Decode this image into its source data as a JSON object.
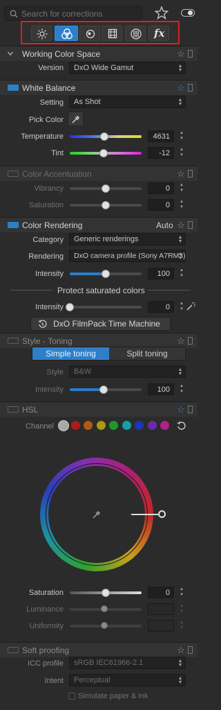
{
  "search": {
    "placeholder": "Search for corrections"
  },
  "toolbar": {
    "tabs": [
      {
        "icon": "sun-icon",
        "active": false
      },
      {
        "icon": "color-circles-icon",
        "active": true
      },
      {
        "icon": "lens-icon",
        "active": false
      },
      {
        "icon": "geometry-icon",
        "active": false
      },
      {
        "icon": "sliders-icon",
        "active": false
      },
      {
        "icon": "fx-icon",
        "active": false
      }
    ],
    "fx_label": "fx"
  },
  "working_color_space": {
    "title": "Working Color Space",
    "version_label": "Version",
    "version_value": "DxO Wide Gamut"
  },
  "white_balance": {
    "title": "White Balance",
    "setting_label": "Setting",
    "setting_value": "As Shot",
    "pick_color_label": "Pick Color",
    "temperature_label": "Temperature",
    "temperature_value": "4631",
    "temperature_position": 0.48,
    "tint_label": "Tint",
    "tint_value": "-12",
    "tint_position": 0.47
  },
  "color_accentuation": {
    "title": "Color Accentuation",
    "vibrancy_label": "Vibrancy",
    "vibrancy_value": "0",
    "vibrancy_position": 0.5,
    "saturation_label": "Saturation",
    "saturation_value": "0",
    "saturation_position": 0.5
  },
  "color_rendering": {
    "title": "Color Rendering",
    "mode": "Auto",
    "category_label": "Category",
    "category_value": "Generic renderings",
    "rendering_label": "Rendering",
    "rendering_value": "DxO camera profile (Sony A7RM3)",
    "intensity_label": "Intensity",
    "intensity_value": "100",
    "intensity_position": 0.5,
    "protect_label": "Protect saturated colors",
    "protect_intensity_label": "Intensity",
    "protect_intensity_value": "0",
    "protect_intensity_position": 0.0,
    "time_machine_label": "DxO FilmPack Time Machine"
  },
  "style_toning": {
    "title": "Style - Toning",
    "simple_label": "Simple toning",
    "split_label": "Split toning",
    "style_label": "Style",
    "style_value": "B&W",
    "intensity_label": "Intensity",
    "intensity_value": "100",
    "intensity_position": 0.47
  },
  "hsl": {
    "title": "HSL",
    "channel_label": "Channel",
    "channels": [
      {
        "name": "all",
        "color": "#a8a8a8"
      },
      {
        "name": "red",
        "color": "#b01a1a"
      },
      {
        "name": "orange",
        "color": "#b45a10"
      },
      {
        "name": "yellow",
        "color": "#a99a10"
      },
      {
        "name": "green",
        "color": "#1e9a2a"
      },
      {
        "name": "cyan",
        "color": "#12a0a8"
      },
      {
        "name": "blue",
        "color": "#1c36b8"
      },
      {
        "name": "purple",
        "color": "#6a2ab0"
      },
      {
        "name": "magenta",
        "color": "#b0208a"
      }
    ],
    "saturation_label": "Saturation",
    "saturation_value": "0",
    "saturation_position": 0.5,
    "luminance_label": "Luminance",
    "uniformity_label": "Uniformity"
  },
  "soft_proofing": {
    "title": "Soft proofing",
    "icc_label": "ICC profile",
    "icc_value": "sRGB IEC61966-2.1",
    "intent_label": "Intent",
    "intent_value": "Perceptual",
    "simulate_label": "Simulate paper & ink"
  }
}
